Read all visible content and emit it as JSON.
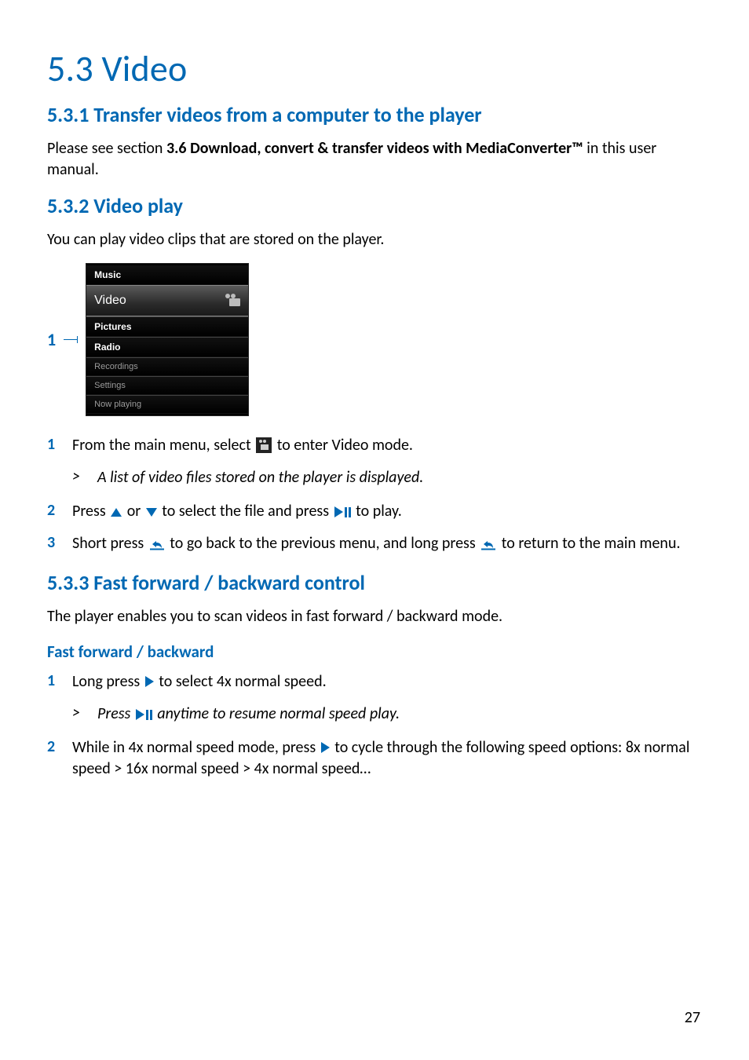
{
  "page_number": "27",
  "h1": "5.3  Video",
  "s1": {
    "title": "5.3.1 Transfer videos from a computer to the player",
    "p1_a": "Please see section ",
    "p1_b": "3.6 Download, convert & transfer videos with MediaConverter™",
    "p1_c": " in this user manual."
  },
  "s2": {
    "title": "5.3.2 Video play",
    "intro": "You can play video clips that are stored on the player.",
    "callout": "1",
    "menu": {
      "m0": "Music",
      "m1": "Video",
      "m2": "Pictures",
      "m3": "Radio",
      "m4": "Recordings",
      "m5": "Settings",
      "m6": "Now playing"
    },
    "step1_num": "1",
    "step1_a": "From the main menu, select ",
    "step1_b": " to enter Video mode.",
    "step1_result": "A list of video files stored on the player is displayed.",
    "step2_num": "2",
    "step2_a": "Press ",
    "step2_b": " or ",
    "step2_c": " to select the file and press ",
    "step2_d": " to play.",
    "step3_num": "3",
    "step3_a": "Short press ",
    "step3_b": " to go back to the previous menu, and long press ",
    "step3_c": " to return to the main menu."
  },
  "s3": {
    "title": "5.3.3 Fast forward / backward control",
    "intro": "The player enables you to scan videos in fast forward / backward mode.",
    "subhead": "Fast forward / backward",
    "step1_num": "1",
    "step1_a": "Long press ",
    "step1_b": " to select 4x normal speed.",
    "step1_result_a": "Press ",
    "step1_result_b": " anytime to resume normal speed play.",
    "step2_num": "2",
    "step2_a": "While in 4x normal speed mode, press ",
    "step2_b": " to cycle through the following speed options: 8x normal speed > 16x normal speed > 4x normal speed…"
  },
  "result_caret": ">"
}
